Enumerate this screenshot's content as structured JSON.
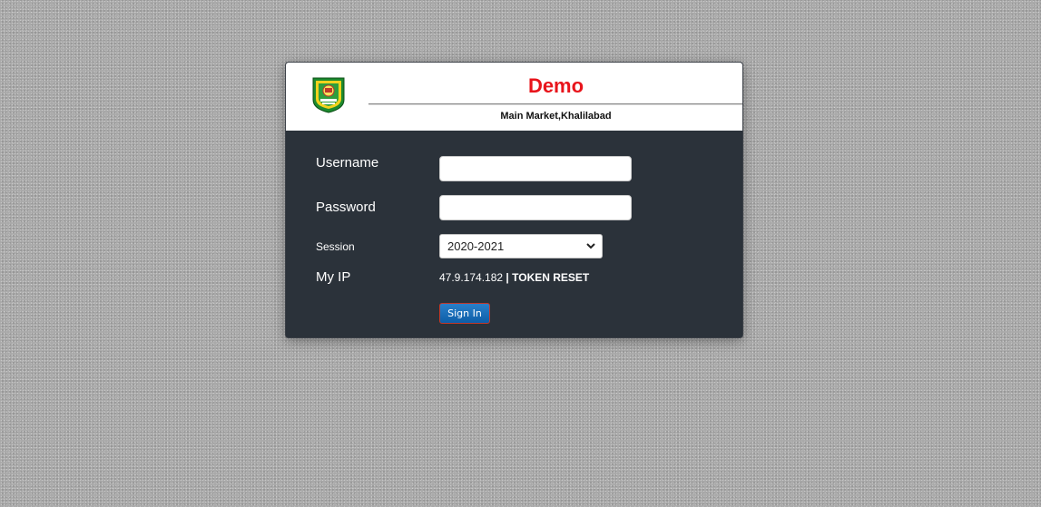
{
  "header": {
    "school_name": "Demo",
    "address": "Main Market,Khalilabad",
    "logo_icon": "school-crest-icon"
  },
  "form": {
    "username_label": "Username",
    "username_value": "",
    "password_label": "Password",
    "password_value": "",
    "session_label": "Session",
    "session_selected": "2020-2021",
    "ip_label": "My IP",
    "ip_value": "47.9.174.182",
    "ip_separator": "|",
    "token_reset_label": "TOKEN RESET",
    "signin_label": "Sign In"
  },
  "colors": {
    "school_name": "#e8141b",
    "form_background": "#2b323a",
    "signin_button": "#0d5ea8",
    "page_background": "#a9a9a9"
  }
}
